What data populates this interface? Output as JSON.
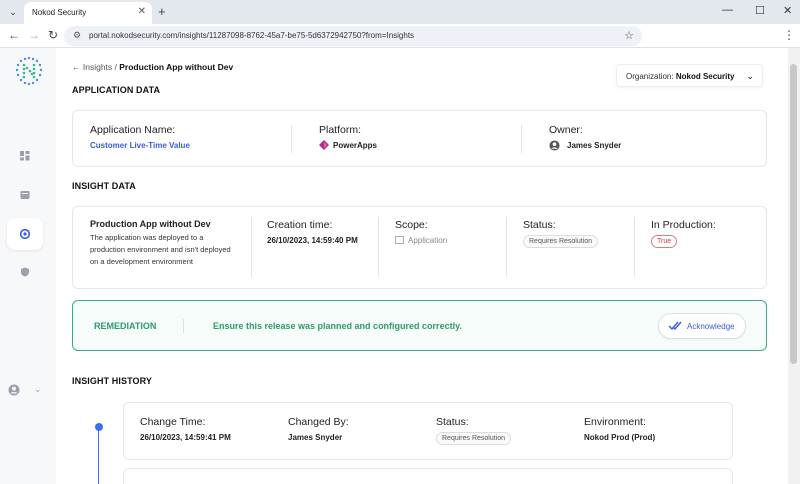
{
  "browser": {
    "tab_title": "Nokod Security",
    "url": "portal.nokodsecurity.com/insights/11287098-8762-45a7-be75-5d6372942750?from=Insights"
  },
  "breadcrumb": {
    "back_label": "← Insights /",
    "current": "Production App without Dev"
  },
  "organization": {
    "label": "Organization:",
    "value": "Nokod Security"
  },
  "application_data": {
    "title": "APPLICATION DATA",
    "name_label": "Application Name:",
    "name_value": "Customer Live-Time Value",
    "platform_label": "Platform:",
    "platform_value": "PowerApps",
    "owner_label": "Owner:",
    "owner_value": "James Snyder"
  },
  "insight_data": {
    "title": "INSIGHT DATA",
    "insight_name": "Production App without Dev",
    "insight_desc": "The application was deployed to a production environment and isn't deployed on a development environment",
    "creation_label": "Creation time:",
    "creation_value": "26/10/2023, 14:59:40 PM",
    "scope_label": "Scope:",
    "scope_value": "Application",
    "status_label": "Status:",
    "status_value": "Requires Resolution",
    "production_label": "In Production:",
    "production_value": "True"
  },
  "remediation": {
    "title": "REMEDIATION",
    "text": "Ensure this release was planned and configured correctly.",
    "button": "Acknowledge"
  },
  "insight_history": {
    "title": "INSIGHT HISTORY",
    "entries": [
      {
        "change_time_label": "Change Time:",
        "change_time": "26/10/2023, 14:59:41 PM",
        "changed_by_label": "Changed By:",
        "changed_by": "James Snyder",
        "status_label": "Status:",
        "status": "Requires Resolution",
        "environment_label": "Environment:",
        "environment": "Nokod Prod (Prod)"
      }
    ]
  },
  "colors": {
    "accent_blue": "#3a5bd9",
    "remediation_green": "#2a9d6a",
    "danger_red": "#d13b3b"
  }
}
